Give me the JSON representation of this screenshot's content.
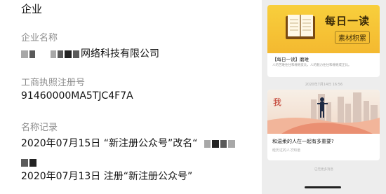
{
  "section_title": "企业",
  "company_name": {
    "label": "企业名称",
    "value_visible": "网络科技有限公司"
  },
  "registration": {
    "label": "工商执照注册号",
    "value": "91460000MA5TJC4F7A"
  },
  "name_history": {
    "label": "名称记录",
    "record1": "2020年07月15日 “新注册公众号”改名“",
    "record2": "2020年07月13日 注册“新注册公众号”"
  },
  "phone_panel": {
    "card1": {
      "banner_title": "每日一读",
      "banner_subtitle": "素材积累",
      "headline": "【每日一读】磨难",
      "summary": "人的苦难往往和缠缠反比，人的魅力往往和缠缠成正比。"
    },
    "timestamp": "2020年7月14日 16:56",
    "card2": {
      "title": "和温柔的人在一起有多重要?",
      "subtitle": "经历过的人才知道"
    },
    "footer_note": "已无更多消息"
  },
  "colors": {
    "banner_yellow": "#f6c436",
    "panel_bg": "#ededed",
    "label_gray": "#8c8c8c"
  }
}
